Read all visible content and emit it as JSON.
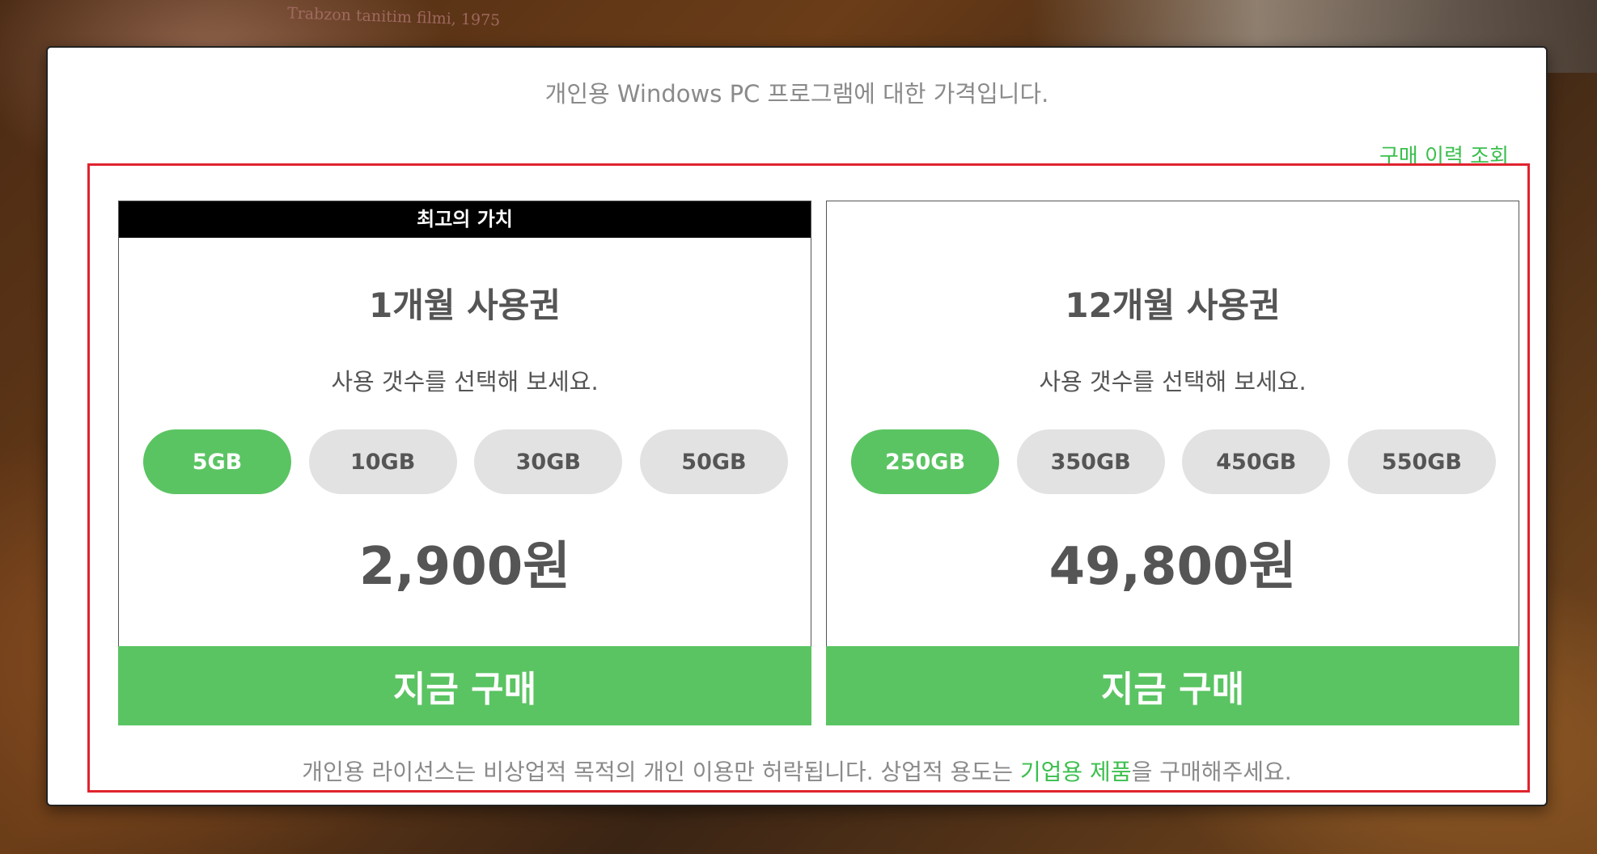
{
  "background": {
    "photo_caption": "Trabzon tanitim filmi, 1975"
  },
  "colors": {
    "accent_green": "#5ac462",
    "link_green": "#3bbf4d",
    "highlight_red": "#e0232e",
    "ribbon_black": "#000000"
  },
  "header": {
    "intro": "개인용 Windows PC 프로그램에 대한 가격입니다.",
    "history_link": "구매 이력 조회"
  },
  "plans": [
    {
      "ribbon": "최고의 가치",
      "title": "1개월 사용권",
      "subtitle": "사용 갯수를 선택해 보세요.",
      "options": [
        "5GB",
        "10GB",
        "30GB",
        "50GB"
      ],
      "selected_option": "5GB",
      "price": "2,900원",
      "buy_label": "지금 구매"
    },
    {
      "title": "12개월 사용권",
      "subtitle": "사용 갯수를 선택해 보세요.",
      "options": [
        "250GB",
        "350GB",
        "450GB",
        "550GB"
      ],
      "selected_option": "250GB",
      "price": "49,800원",
      "buy_label": "지금 구매"
    }
  ],
  "footer": {
    "note_before": "개인용 라이선스는 비상업적 목적의 개인 이용만 허락됩니다. 상업적 용도는 ",
    "note_link": "기업용 제품",
    "note_after": "을 구매해주세요."
  }
}
